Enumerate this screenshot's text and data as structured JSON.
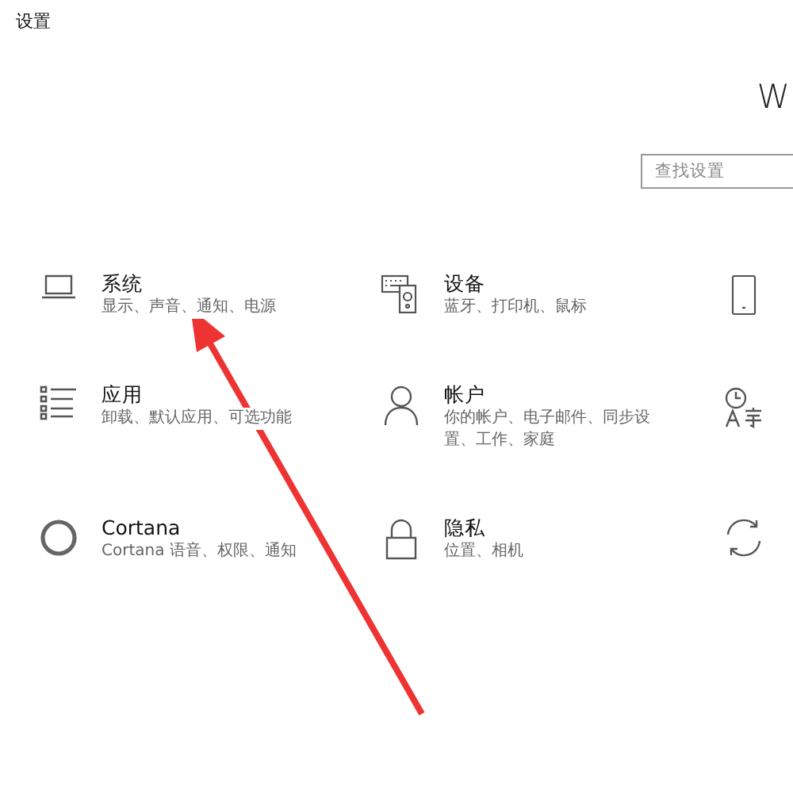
{
  "window": {
    "title": "设置"
  },
  "header": {
    "title": "W"
  },
  "search": {
    "placeholder": "查找设置"
  },
  "categories": [
    {
      "kind": "laptop",
      "title": "系统",
      "subtitle": "显示、声音、通知、电源"
    },
    {
      "kind": "keyboard-speaker",
      "title": "设备",
      "subtitle": "蓝牙、打印机、鼠标"
    },
    {
      "kind": "phone"
    },
    {
      "kind": "list",
      "title": "应用",
      "subtitle": "卸载、默认应用、可选功能"
    },
    {
      "kind": "person",
      "title": "帐户",
      "subtitle": "你的帐户、电子邮件、同步设置、工作、家庭"
    },
    {
      "kind": "clock-lang"
    },
    {
      "kind": "circle",
      "title": "Cortana",
      "subtitle": "Cortana 语音、权限、通知"
    },
    {
      "kind": "lock",
      "title": "隐私",
      "subtitle": "位置、相机"
    },
    {
      "kind": "sync"
    }
  ],
  "annotation": {
    "kind": "arrow"
  }
}
